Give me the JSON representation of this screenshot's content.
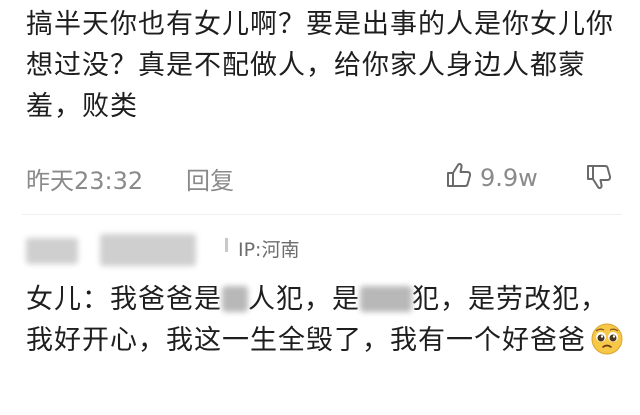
{
  "comment1": {
    "text": "搞半天你也有女儿啊？要是出事的人是你女儿你想过没？真是不配做人，给你家人身边人都蒙羞，败类",
    "time": "昨天23:32",
    "reply_label": "回复",
    "like_count": "9.9w"
  },
  "comment2": {
    "ip_label": "IP:河南",
    "seg1": "女儿：我爸爸是",
    "seg2": "人犯，是",
    "seg3": "犯，是劳改犯，我好开心，我这一生全毁了，我有一个好爸爸"
  },
  "icons": {
    "like": "thumbs-up-icon",
    "dislike": "thumbs-down-icon",
    "emoji": "pleading-face-emoji"
  },
  "colors": {
    "meta_text": "#8a8a8a",
    "emoji_yellow": "#f7c748"
  }
}
